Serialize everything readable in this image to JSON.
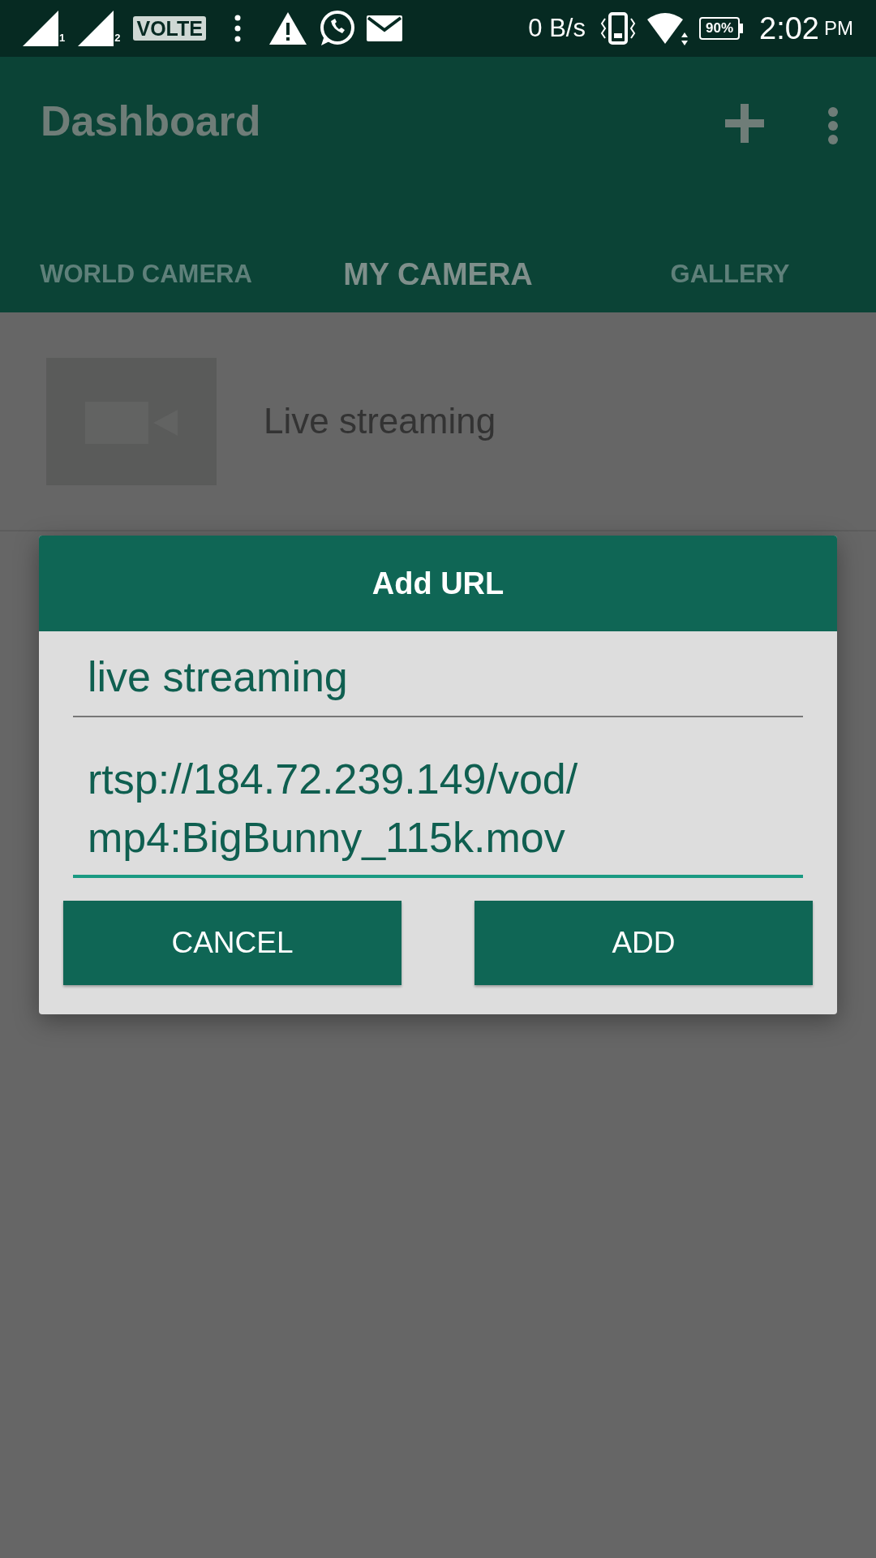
{
  "status_bar": {
    "sim_labels": [
      "1",
      "2"
    ],
    "volte": "VOLTE",
    "net_speed": "0 B/s",
    "battery": "90%",
    "time": "2:02",
    "ampm": "PM"
  },
  "app_bar": {
    "title": "Dashboard"
  },
  "tabs": [
    {
      "label": "WORLD CAMERA",
      "selected": false
    },
    {
      "label": "MY CAMERA",
      "selected": true
    },
    {
      "label": "GALLERY",
      "selected": false
    }
  ],
  "list": [
    {
      "title": "Live streaming"
    }
  ],
  "dialog": {
    "title": "Add URL",
    "fields": [
      {
        "value": "live streaming",
        "focused": false
      },
      {
        "value": "rtsp://184.72.239.149/vod/\nmp4:BigBunny_115k.mov",
        "focused": true
      }
    ],
    "buttons": [
      "CANCEL",
      "ADD"
    ]
  }
}
